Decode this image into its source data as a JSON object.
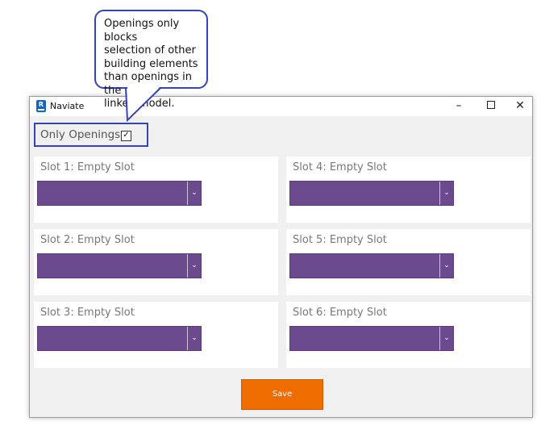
{
  "callout": {
    "lines": [
      "Openings only blocks",
      "selection of other",
      "building elements",
      "than openings in the",
      "linked model."
    ]
  },
  "window": {
    "title": "Naviate",
    "icon_letter": "R",
    "controls": {
      "minimize": "–",
      "maximize": "",
      "close": "✕"
    }
  },
  "only_openings": {
    "label": "Only Openings:",
    "checked": true,
    "check_glyph": "✓"
  },
  "slots": [
    {
      "label": "Slot 1: Empty Slot",
      "value": ""
    },
    {
      "label": "Slot 2: Empty Slot",
      "value": ""
    },
    {
      "label": "Slot 3: Empty Slot",
      "value": ""
    },
    {
      "label": "Slot 4: Empty Slot",
      "value": ""
    },
    {
      "label": "Slot 5: Empty Slot",
      "value": ""
    },
    {
      "label": "Slot 6: Empty Slot",
      "value": ""
    }
  ],
  "dropdown_arrow": "⌄",
  "save_label": "Save",
  "colors": {
    "accent_purple": "#6b4a8d",
    "save_orange": "#ef6c00",
    "callout_border": "#3344bb"
  }
}
